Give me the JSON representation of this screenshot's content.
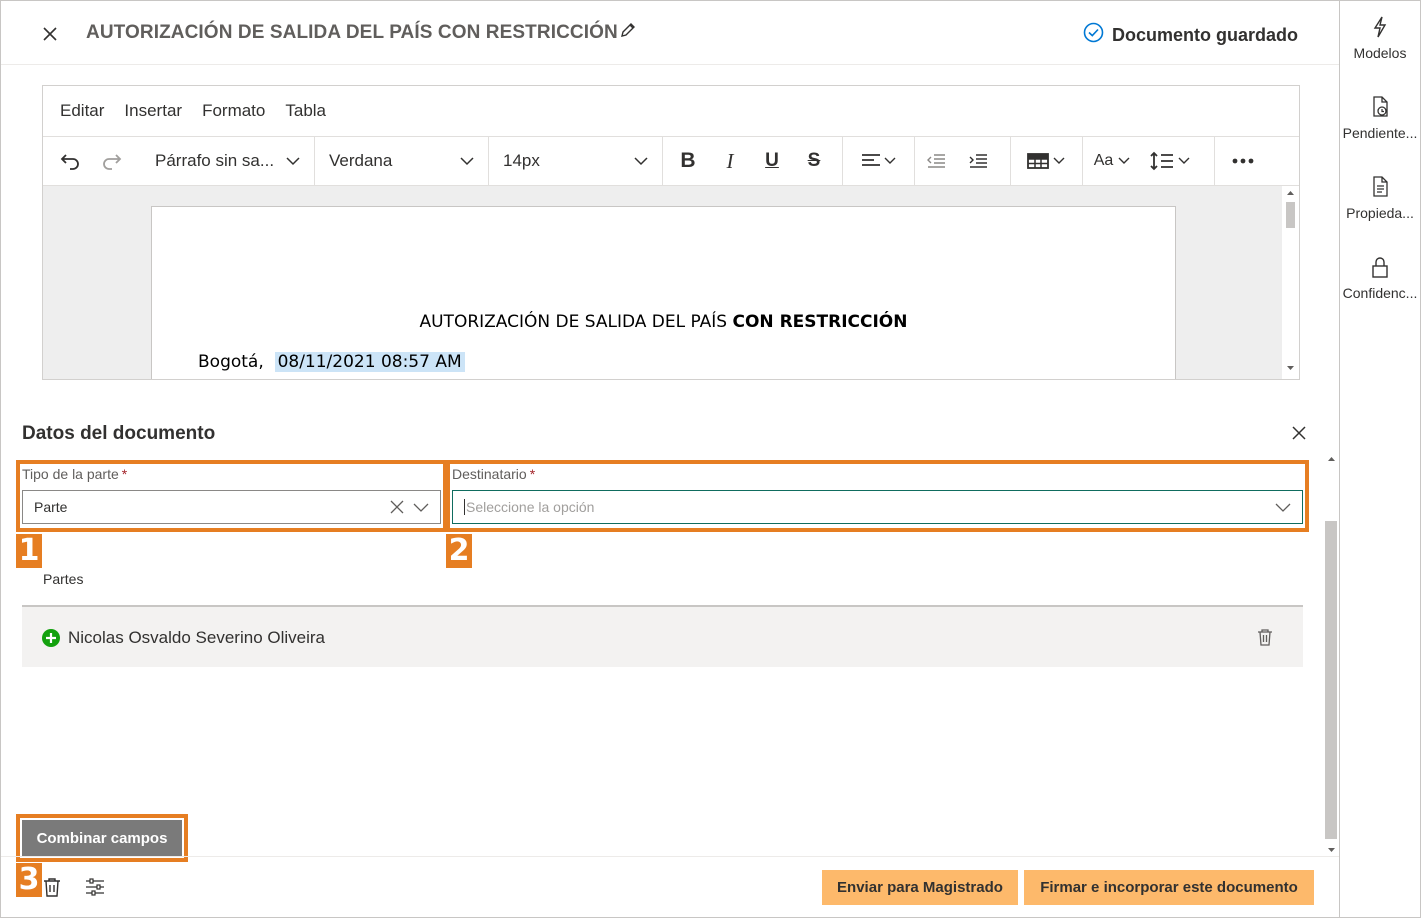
{
  "header": {
    "title": "AUTORIZACIÓN DE SALIDA DEL PAÍS CON RESTRICCIÓN",
    "saved_status": "Documento guardado"
  },
  "right_panel": {
    "items": [
      {
        "label": "Modelos",
        "icon": "lightning-icon"
      },
      {
        "label": "Pendiente...",
        "icon": "document-clock-icon"
      },
      {
        "label": "Propieda...",
        "icon": "document-list-icon"
      },
      {
        "label": "Confidenc...",
        "icon": "lock-icon"
      }
    ]
  },
  "editor": {
    "menu": [
      "Editar",
      "Insertar",
      "Formato",
      "Tabla"
    ],
    "paragraph_style": "Párrafo sin sa...",
    "font_family": "Verdana",
    "font_size": "14px",
    "font_size_alt": "Aa",
    "document": {
      "title_normal": "AUTORIZACIÓN DE SALIDA DEL PAÍS ",
      "title_bold": "CON RESTRICCIÓN",
      "city": "Bogotá,",
      "date": "08/11/2021 08:57 AM"
    }
  },
  "datos": {
    "title": "Datos del documento",
    "tipo_parte": {
      "label": "Tipo de la parte",
      "required_mark": "*",
      "value": "Parte"
    },
    "destinatario": {
      "label": "Destinatario",
      "required_mark": "*",
      "placeholder": "Seleccione la opción"
    },
    "partes_label": "Partes",
    "partes": [
      {
        "name": "Nicolas Osvaldo Severino Oliveira"
      }
    ],
    "combinar_label": "Combinar campos"
  },
  "annotations": {
    "n1": "1",
    "n2": "2",
    "n3": "3"
  },
  "footer": {
    "enviar_label": "Enviar para Magistrado",
    "firmar_label": "Firmar e incorporar este documento"
  },
  "colors": {
    "accent_orange": "#e67e22",
    "button_orange": "#fdb96b",
    "saved_check": "#0078d4",
    "add_green": "#13a10e"
  }
}
